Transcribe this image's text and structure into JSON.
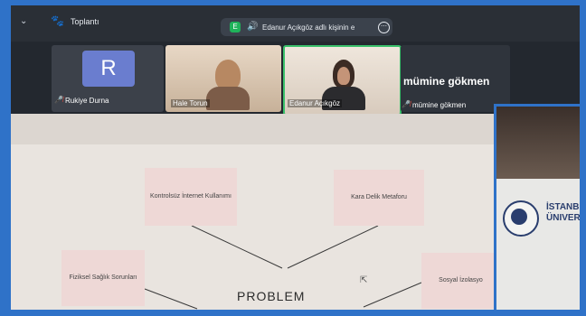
{
  "header": {
    "title": "Toplantı",
    "share_badge": "E",
    "share_text": "Edanur Açıkgöz adlı kişinin e"
  },
  "participants": [
    {
      "name": "Rukiye Durna",
      "avatar_letter": "R",
      "muted": true
    },
    {
      "name": "Hale Torun",
      "muted": false
    },
    {
      "name": "Edanur Açıkgöz",
      "muted": false,
      "active_speaker": true
    },
    {
      "name": "mümine gökmen",
      "display_name": "mümine gökmen",
      "muted": true
    }
  ],
  "slide": {
    "boxes": [
      {
        "text": "Kontrolsüz İnternet Kullanımı"
      },
      {
        "text": "Kara Delik Metaforu"
      },
      {
        "text": "Fiziksel Sağlık Sorunları"
      },
      {
        "text": "Sosyal İzolasyo"
      }
    ],
    "center": "PROBLEM"
  },
  "photo": {
    "text_line1": "İSTANB",
    "text_line2": "ÜNIVER"
  },
  "colors": {
    "accent_green": "#1fb35a",
    "frame_blue": "#2f72c8",
    "muted_red": "#e0473a"
  }
}
